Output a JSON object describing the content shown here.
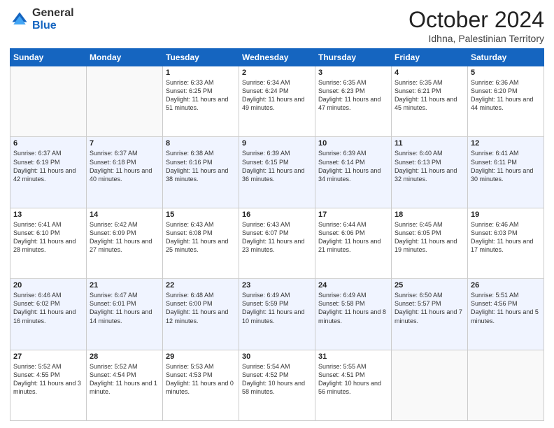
{
  "logo": {
    "general": "General",
    "blue": "Blue"
  },
  "header": {
    "month": "October 2024",
    "location": "Idhna, Palestinian Territory"
  },
  "weekdays": [
    "Sunday",
    "Monday",
    "Tuesday",
    "Wednesday",
    "Thursday",
    "Friday",
    "Saturday"
  ],
  "weeks": [
    [
      {
        "day": "",
        "info": ""
      },
      {
        "day": "",
        "info": ""
      },
      {
        "day": "1",
        "info": "Sunrise: 6:33 AM\nSunset: 6:25 PM\nDaylight: 11 hours and 51 minutes."
      },
      {
        "day": "2",
        "info": "Sunrise: 6:34 AM\nSunset: 6:24 PM\nDaylight: 11 hours and 49 minutes."
      },
      {
        "day": "3",
        "info": "Sunrise: 6:35 AM\nSunset: 6:23 PM\nDaylight: 11 hours and 47 minutes."
      },
      {
        "day": "4",
        "info": "Sunrise: 6:35 AM\nSunset: 6:21 PM\nDaylight: 11 hours and 45 minutes."
      },
      {
        "day": "5",
        "info": "Sunrise: 6:36 AM\nSunset: 6:20 PM\nDaylight: 11 hours and 44 minutes."
      }
    ],
    [
      {
        "day": "6",
        "info": "Sunrise: 6:37 AM\nSunset: 6:19 PM\nDaylight: 11 hours and 42 minutes."
      },
      {
        "day": "7",
        "info": "Sunrise: 6:37 AM\nSunset: 6:18 PM\nDaylight: 11 hours and 40 minutes."
      },
      {
        "day": "8",
        "info": "Sunrise: 6:38 AM\nSunset: 6:16 PM\nDaylight: 11 hours and 38 minutes."
      },
      {
        "day": "9",
        "info": "Sunrise: 6:39 AM\nSunset: 6:15 PM\nDaylight: 11 hours and 36 minutes."
      },
      {
        "day": "10",
        "info": "Sunrise: 6:39 AM\nSunset: 6:14 PM\nDaylight: 11 hours and 34 minutes."
      },
      {
        "day": "11",
        "info": "Sunrise: 6:40 AM\nSunset: 6:13 PM\nDaylight: 11 hours and 32 minutes."
      },
      {
        "day": "12",
        "info": "Sunrise: 6:41 AM\nSunset: 6:11 PM\nDaylight: 11 hours and 30 minutes."
      }
    ],
    [
      {
        "day": "13",
        "info": "Sunrise: 6:41 AM\nSunset: 6:10 PM\nDaylight: 11 hours and 28 minutes."
      },
      {
        "day": "14",
        "info": "Sunrise: 6:42 AM\nSunset: 6:09 PM\nDaylight: 11 hours and 27 minutes."
      },
      {
        "day": "15",
        "info": "Sunrise: 6:43 AM\nSunset: 6:08 PM\nDaylight: 11 hours and 25 minutes."
      },
      {
        "day": "16",
        "info": "Sunrise: 6:43 AM\nSunset: 6:07 PM\nDaylight: 11 hours and 23 minutes."
      },
      {
        "day": "17",
        "info": "Sunrise: 6:44 AM\nSunset: 6:06 PM\nDaylight: 11 hours and 21 minutes."
      },
      {
        "day": "18",
        "info": "Sunrise: 6:45 AM\nSunset: 6:05 PM\nDaylight: 11 hours and 19 minutes."
      },
      {
        "day": "19",
        "info": "Sunrise: 6:46 AM\nSunset: 6:03 PM\nDaylight: 11 hours and 17 minutes."
      }
    ],
    [
      {
        "day": "20",
        "info": "Sunrise: 6:46 AM\nSunset: 6:02 PM\nDaylight: 11 hours and 16 minutes."
      },
      {
        "day": "21",
        "info": "Sunrise: 6:47 AM\nSunset: 6:01 PM\nDaylight: 11 hours and 14 minutes."
      },
      {
        "day": "22",
        "info": "Sunrise: 6:48 AM\nSunset: 6:00 PM\nDaylight: 11 hours and 12 minutes."
      },
      {
        "day": "23",
        "info": "Sunrise: 6:49 AM\nSunset: 5:59 PM\nDaylight: 11 hours and 10 minutes."
      },
      {
        "day": "24",
        "info": "Sunrise: 6:49 AM\nSunset: 5:58 PM\nDaylight: 11 hours and 8 minutes."
      },
      {
        "day": "25",
        "info": "Sunrise: 6:50 AM\nSunset: 5:57 PM\nDaylight: 11 hours and 7 minutes."
      },
      {
        "day": "26",
        "info": "Sunrise: 5:51 AM\nSunset: 4:56 PM\nDaylight: 11 hours and 5 minutes."
      }
    ],
    [
      {
        "day": "27",
        "info": "Sunrise: 5:52 AM\nSunset: 4:55 PM\nDaylight: 11 hours and 3 minutes."
      },
      {
        "day": "28",
        "info": "Sunrise: 5:52 AM\nSunset: 4:54 PM\nDaylight: 11 hours and 1 minute."
      },
      {
        "day": "29",
        "info": "Sunrise: 5:53 AM\nSunset: 4:53 PM\nDaylight: 11 hours and 0 minutes."
      },
      {
        "day": "30",
        "info": "Sunrise: 5:54 AM\nSunset: 4:52 PM\nDaylight: 10 hours and 58 minutes."
      },
      {
        "day": "31",
        "info": "Sunrise: 5:55 AM\nSunset: 4:51 PM\nDaylight: 10 hours and 56 minutes."
      },
      {
        "day": "",
        "info": ""
      },
      {
        "day": "",
        "info": ""
      }
    ]
  ]
}
